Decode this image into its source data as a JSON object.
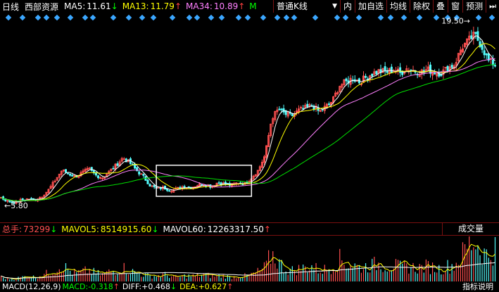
{
  "header": {
    "period": "日线",
    "stock_name": "西部资源",
    "ma5_label": "MA5:",
    "ma5_value": "11.61",
    "ma5_arrow": "↓",
    "ma13_label": "MA13:",
    "ma13_value": "11.79",
    "ma13_arrow": "↑",
    "ma34_label": "MA34:",
    "ma34_value": "10.89",
    "ma34_arrow": "↑",
    "m_label": "M"
  },
  "toolbar": {
    "kline_type": "普通K线",
    "dropdown_glyph": "▼",
    "inner": "内",
    "add_watch": "加自选",
    "ma_lines": "均线",
    "ex_right": "除权",
    "overlay": "叠",
    "window": "窗",
    "forecast": "预测",
    "nav_glyph": "⏭"
  },
  "price": {
    "high_label": "19.50",
    "low_label": "5.80",
    "high_arrow": "→",
    "low_arrow": "←"
  },
  "volume": {
    "total_label": "总手:",
    "total_value": "73299",
    "total_arrow": "↓",
    "mavol5_label": "MAVOL5:",
    "mavol5_value": "8514915.60",
    "mavol5_arrow": "↓",
    "mavol60_label": "MAVOL60:",
    "mavol60_value": "12263317.50",
    "mavol60_arrow": "↑",
    "button": "成交量"
  },
  "macd": {
    "label": "MACD(12,26,9)",
    "macd_label": "MACD:",
    "macd_value": "-0.318",
    "macd_arrow": "↑",
    "diff_label": "DIFF:",
    "diff_value": "+0.468",
    "diff_arrow": "↓",
    "dea_label": "DEA:",
    "dea_value": "+0.627",
    "dea_arrow": "↑",
    "help": "指标说明"
  },
  "colors": {
    "up": "#ff5050",
    "up_alt": "#54fcfc",
    "down": "#54fcfc",
    "ma5": "#ffffff",
    "ma13": "#ffff00",
    "ma34": "#ff80ff",
    "ma60": "#00e000",
    "diamond": "#3ba7ff",
    "frame": "#7a1010"
  },
  "chart_data": {
    "type": "candlestick",
    "ylim": [
      5.0,
      20.5
    ],
    "price_path": [
      6.2,
      5.9,
      5.8,
      6.0,
      6.1,
      6.0,
      6.3,
      6.8,
      7.6,
      8.4,
      8.1,
      7.9,
      8.2,
      8.5,
      8.0,
      7.8,
      8.3,
      8.8,
      9.4,
      9.0,
      8.4,
      7.9,
      7.2,
      6.9,
      7.0,
      6.8,
      6.9,
      7.1,
      7.0,
      7.2,
      7.3,
      7.1,
      7.4,
      7.3,
      7.2,
      7.4,
      7.3,
      7.8,
      8.4,
      9.6,
      12.6,
      13.3,
      12.9,
      12.8,
      13.2,
      13.4,
      13.6,
      13.1,
      13.5,
      14.0,
      15.2,
      15.5,
      15.8,
      15.5,
      15.9,
      16.2,
      16.4,
      16.3,
      16.5,
      16.2,
      16.6,
      16.4,
      16.3,
      16.5,
      16.3,
      16.2,
      16.6,
      16.9,
      18.2,
      18.8,
      19.3,
      18.4,
      17.2,
      16.9
    ],
    "volume_path": [
      3,
      2,
      2,
      3,
      4,
      3,
      5,
      6,
      9,
      12,
      8,
      6,
      7,
      8,
      6,
      5,
      7,
      8,
      10,
      8,
      6,
      5,
      4,
      4,
      5,
      4,
      3,
      4,
      4,
      4,
      5,
      4,
      4,
      4,
      3,
      4,
      4,
      5,
      7,
      10,
      20,
      14,
      9,
      8,
      9,
      10,
      11,
      8,
      9,
      11,
      16,
      13,
      12,
      10,
      11,
      12,
      13,
      11,
      12,
      10,
      11,
      10,
      10,
      11,
      10,
      9,
      11,
      12,
      18,
      26,
      30,
      22,
      18,
      24
    ],
    "highlight_box_range": [
      23,
      37
    ]
  }
}
